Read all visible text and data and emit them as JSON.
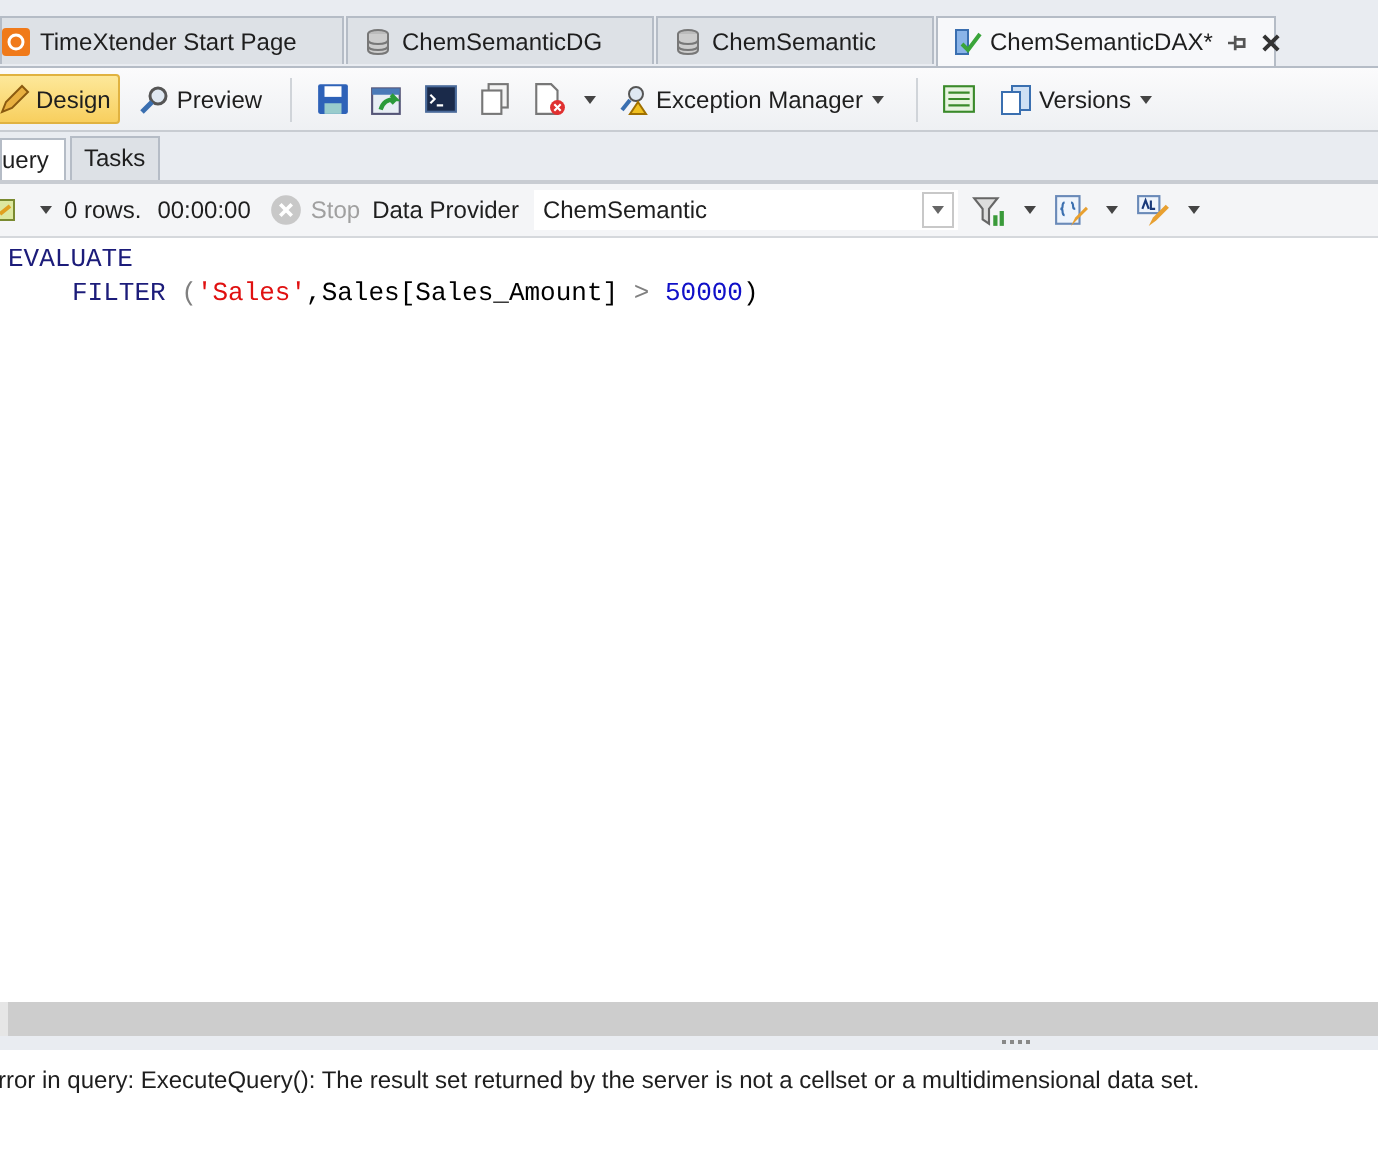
{
  "document_tabs": [
    {
      "kind": "start",
      "label": "TimeXtender Start Page",
      "selected": false
    },
    {
      "kind": "database",
      "label": "ChemSemanticDG",
      "selected": false
    },
    {
      "kind": "database",
      "label": "ChemSemantic",
      "selected": false
    },
    {
      "kind": "dax",
      "label": "ChemSemanticDAX*",
      "selected": true
    }
  ],
  "toolbar": {
    "modes": [
      {
        "label": "Design",
        "selected": true
      },
      {
        "label": "Preview",
        "selected": false
      }
    ],
    "exception_manager": "Exception Manager",
    "versions": "Versions"
  },
  "view_tabs": [
    {
      "label": "uery",
      "selected": true
    },
    {
      "label": "Tasks",
      "selected": false
    }
  ],
  "query_bar": {
    "rows": "0 rows.",
    "elapsed": "00:00:00",
    "stop": {
      "label": "Stop",
      "disabled": true
    },
    "provider_label": "Data Provider",
    "provider": "ChemSemantic"
  },
  "editor": {
    "lines": [
      {
        "indented": false,
        "tokens": [
          {
            "kind": "keyword",
            "text": "EVALUATE"
          }
        ]
      },
      {
        "indented": true,
        "tokens": [
          {
            "kind": "keyword",
            "text": "FILTER"
          },
          {
            "kind": "operator",
            "text": " ("
          },
          {
            "kind": "string",
            "text": "'Sales'"
          },
          {
            "kind": "plain",
            "text": ",Sales[Sales_Amount]"
          },
          {
            "kind": "operator",
            "text": " > "
          },
          {
            "kind": "number",
            "text": "50000"
          },
          {
            "kind": "plain",
            "text": ")"
          }
        ]
      }
    ]
  },
  "error": "rror in query: ExecuteQuery(): The result set returned by the server is not a cellset or a multidimensional data set."
}
